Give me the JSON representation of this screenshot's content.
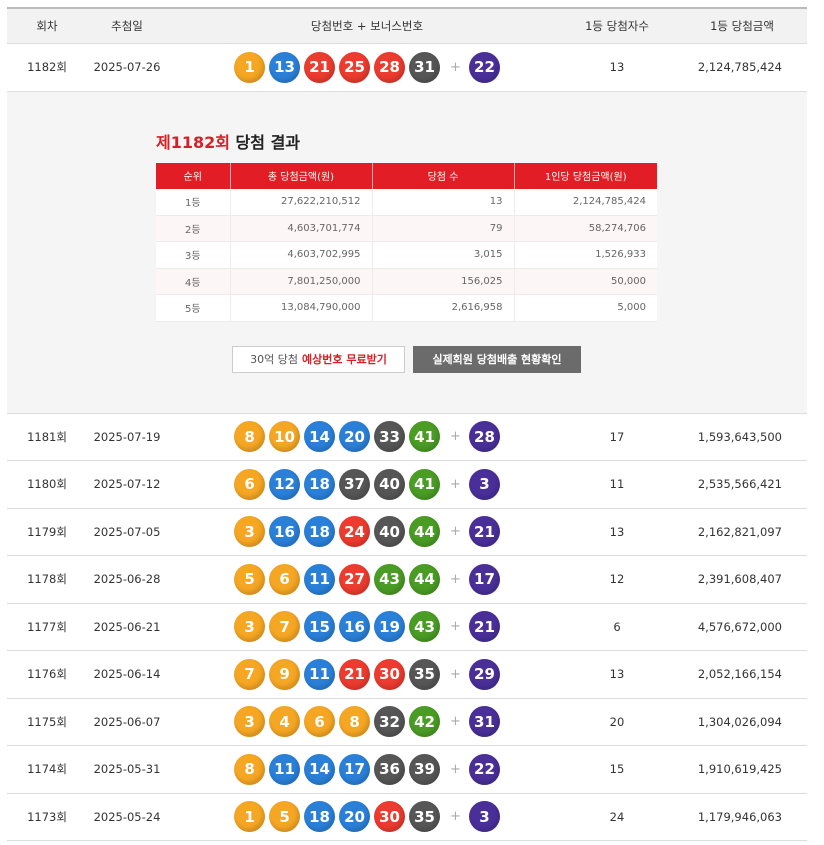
{
  "colors": {
    "yellow": "#f5a623",
    "blue": "#2a80d8",
    "red": "#ec3b2f",
    "gray": "#565656",
    "green": "#4a9c24",
    "purple": "#4a2f99"
  },
  "header": {
    "round": "회차",
    "date": "추첨일",
    "numbers": "당첨번호 + 보너스번호",
    "winners": "1등 당첨자수",
    "prize": "1등 당첨금액"
  },
  "plus_symbol": "+",
  "draws": [
    {
      "round": "1182회",
      "date": "2025-07-26",
      "balls": [
        1,
        13,
        21,
        25,
        28,
        31
      ],
      "bonus": 22,
      "winners": "13",
      "prize": "2,124,785,424"
    },
    {
      "round": "1181회",
      "date": "2025-07-19",
      "balls": [
        8,
        10,
        14,
        20,
        33,
        41
      ],
      "bonus": 28,
      "winners": "17",
      "prize": "1,593,643,500"
    },
    {
      "round": "1180회",
      "date": "2025-07-12",
      "balls": [
        6,
        12,
        18,
        37,
        40,
        41
      ],
      "bonus": 3,
      "winners": "11",
      "prize": "2,535,566,421"
    },
    {
      "round": "1179회",
      "date": "2025-07-05",
      "balls": [
        3,
        16,
        18,
        24,
        40,
        44
      ],
      "bonus": 21,
      "winners": "13",
      "prize": "2,162,821,097"
    },
    {
      "round": "1178회",
      "date": "2025-06-28",
      "balls": [
        5,
        6,
        11,
        27,
        43,
        44
      ],
      "bonus": 17,
      "winners": "12",
      "prize": "2,391,608,407"
    },
    {
      "round": "1177회",
      "date": "2025-06-21",
      "balls": [
        3,
        7,
        15,
        16,
        19,
        43
      ],
      "bonus": 21,
      "winners": "6",
      "prize": "4,576,672,000"
    },
    {
      "round": "1176회",
      "date": "2025-06-14",
      "balls": [
        7,
        9,
        11,
        21,
        30,
        35
      ],
      "bonus": 29,
      "winners": "13",
      "prize": "2,052,166,154"
    },
    {
      "round": "1175회",
      "date": "2025-06-07",
      "balls": [
        3,
        4,
        6,
        8,
        32,
        42
      ],
      "bonus": 31,
      "winners": "20",
      "prize": "1,304,026,094"
    },
    {
      "round": "1174회",
      "date": "2025-05-31",
      "balls": [
        8,
        11,
        14,
        17,
        36,
        39
      ],
      "bonus": 22,
      "winners": "15",
      "prize": "1,910,619,425"
    },
    {
      "round": "1173회",
      "date": "2025-05-24",
      "balls": [
        1,
        5,
        18,
        20,
        30,
        35
      ],
      "bonus": 3,
      "winners": "24",
      "prize": "1,179,946,063"
    }
  ],
  "detail": {
    "title_red": "제1182회",
    "title_rest": " 당첨 결과",
    "columns": [
      "순위",
      "총 당첨금액(원)",
      "당첨 수",
      "1인당 당첨금액(원)"
    ],
    "rows": [
      [
        "1등",
        "27,622,210,512",
        "13",
        "2,124,785,424"
      ],
      [
        "2등",
        "4,603,701,774",
        "79",
        "58,274,706"
      ],
      [
        "3등",
        "4,603,702,995",
        "3,015",
        "1,526,933"
      ],
      [
        "4등",
        "7,801,250,000",
        "156,025",
        "50,000"
      ],
      [
        "5등",
        "13,084,790,000",
        "2,616,958",
        "5,000"
      ]
    ],
    "btn_free_prefix": "30억 당첨",
    "btn_free_accent": "예상번호 무료받기",
    "btn_check": "실제회원 당첨배출 현황확인"
  }
}
